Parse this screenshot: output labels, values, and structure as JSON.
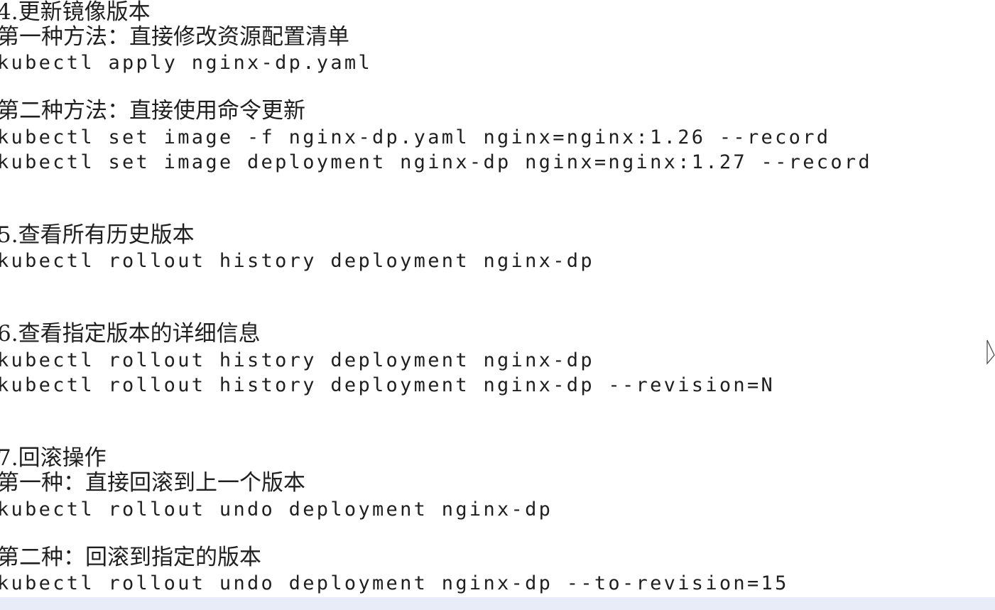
{
  "document": {
    "lines": [
      {
        "text": "4.更新镜像版本",
        "kind": "heading"
      },
      {
        "text": "第一种方法：直接修改资源配置清单",
        "kind": "heading"
      },
      {
        "text": "kubectl apply nginx-dp.yaml",
        "kind": "code"
      },
      {
        "text": "第二种方法：直接使用命令更新",
        "kind": "heading"
      },
      {
        "text": "kubectl set image -f nginx-dp.yaml nginx=nginx:1.26 --record",
        "kind": "code"
      },
      {
        "text": "kubectl set image deployment nginx-dp nginx=nginx:1.27 --record",
        "kind": "code"
      },
      {
        "text": "5.查看所有历史版本",
        "kind": "heading"
      },
      {
        "text": "kubectl rollout history deployment nginx-dp",
        "kind": "code"
      },
      {
        "text": "6.查看指定版本的详细信息",
        "kind": "heading"
      },
      {
        "text": "kubectl rollout history deployment nginx-dp",
        "kind": "code"
      },
      {
        "text": "kubectl rollout history deployment nginx-dp --revision=N",
        "kind": "code"
      },
      {
        "text": "7.回滚操作",
        "kind": "heading"
      },
      {
        "text": "第一种：直接回滚到上一个版本",
        "kind": "heading"
      },
      {
        "text": "kubectl rollout undo deployment nginx-dp",
        "kind": "code"
      },
      {
        "text": "第二种：回滚到指定的版本",
        "kind": "heading"
      },
      {
        "text": "kubectl rollout undo deployment nginx-dp --to-revision=15",
        "kind": "code"
      }
    ]
  },
  "icons": {
    "cursor": "mouse-pointer-icon"
  },
  "colors": {
    "text": "#1f1f1f",
    "background": "#ffffff",
    "bottom_band": "#e8ebf8"
  }
}
